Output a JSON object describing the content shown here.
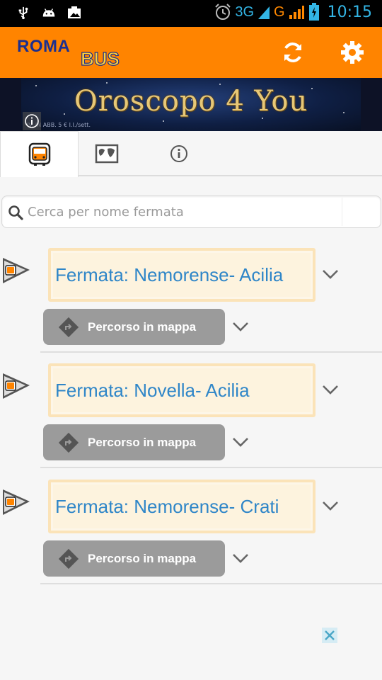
{
  "status_bar": {
    "network_1": "3G",
    "network_2": "G",
    "time": "10:15",
    "icons": [
      "usb-icon",
      "android-debug-icon",
      "screenshot-icon",
      "alarm-icon",
      "signal-icon",
      "battery-charging-icon"
    ]
  },
  "app_bar": {
    "logo_roma": "ROMA",
    "logo_bus": "BUS",
    "refresh_icon": "refresh-icon",
    "settings_icon": "gear-icon",
    "bg_color": "#ff8400"
  },
  "ad": {
    "title": "Oroscopo 4 You",
    "fine_print": "IV. IN ABB. 5 € I.I./sett.",
    "info_icon": "info-icon"
  },
  "tabs": [
    {
      "icon": "bus-icon",
      "active": true
    },
    {
      "icon": "map-icon",
      "active": false
    },
    {
      "icon": "info-icon",
      "active": false
    }
  ],
  "search": {
    "placeholder": "Cerca per nome fermata",
    "value": ""
  },
  "stops": [
    {
      "name": "Fermata: Nemorense- Acilia",
      "route_label": "Percorso in mappa"
    },
    {
      "name": "Fermata: Novella- Acilia",
      "route_label": "Percorso in mappa"
    },
    {
      "name": "Fermata: Nemorense- Crati",
      "route_label": "Percorso in mappa"
    }
  ],
  "colors": {
    "accent": "#ff8400",
    "stop_text": "#2f86c8",
    "route_button": "#9b9b9b"
  },
  "close_ad_icon": "close-icon"
}
